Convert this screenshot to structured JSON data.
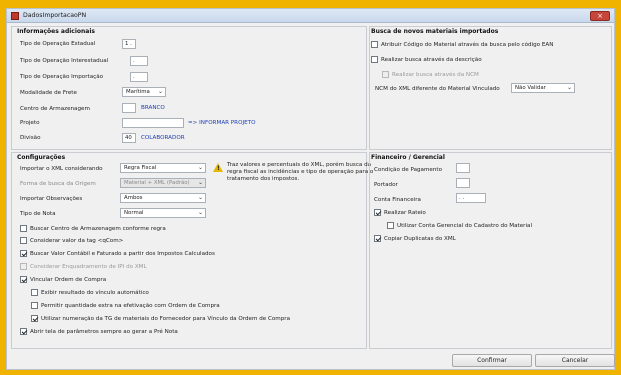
{
  "window": {
    "title": "DadosImportacaoPN",
    "close_glyph": "×",
    "app_icon": "app-icon"
  },
  "info": {
    "title": "Informações adicionais",
    "tipo_estadual": {
      "label": "Tipo de Operação Estadual",
      "value": "1  ."
    },
    "tipo_interestadual": {
      "label": "Tipo de Operação Interestadual",
      "value": "."
    },
    "tipo_importacao": {
      "label": "Tipo de Operação Importação",
      "value": "."
    },
    "modalidade": {
      "label": "Modalidade de Frete",
      "value": "Marítima"
    },
    "centro": {
      "label": "Centro de Armazenagem",
      "value": "",
      "link": "BRANCO"
    },
    "projeto": {
      "label": "Projeto",
      "value": "",
      "link": "=> INFORMAR PROJETO"
    },
    "divisao": {
      "label": "Divisão",
      "value": "40",
      "link": "COLABORADOR"
    }
  },
  "busca": {
    "title": "Busca de novos materiais importados",
    "opt1": "Atribuir Código do Material através da busca pelo código EAN",
    "opt2": "Realizar busca através da descrição",
    "opt3": "Realizar busca através da NCM",
    "ncm_label": "NCM do XML diferente do Material Vinculado",
    "ncm_value": "Não Validar"
  },
  "config": {
    "title": "Configurações",
    "importar": {
      "label": "Importar o XML considerando",
      "value": "Regra Fiscal"
    },
    "forma": {
      "label": "Forma de busca da Origem",
      "value": "Material + XML (Padrão)"
    },
    "observacoes": {
      "label": "Importar Observações",
      "value": "Ambos"
    },
    "tipo_nota": {
      "label": "Tipo de Nota",
      "value": "Normal"
    },
    "warning": "Traz valores e percentuais do XML, porém busca da regra fiscal as incidências e tipo de operação para o tratamento dos impostos.",
    "checks": [
      "Buscar Centro de Armazenagem conforme regra",
      "Considerar valor da tag <qCom>",
      "Buscar Valor Contábil e Faturado a partir dos Impostos Calculados",
      "Considerar Enquadramento de IPI do XML",
      "Vincular Ordem de Compra",
      "Exibir resultado do vínculo automático",
      "Permitir quantidade extra na efetivação com Ordem de Compra",
      "Utilizar numeração da TG de materiais do Fornecedor para Vínculo da Ordem de Compra",
      "Abrir tela de parâmetros sempre ao gerar a Pré Nota"
    ]
  },
  "fin": {
    "title": "Financeiro / Gerencial",
    "condicao": "Condição de Pagamento",
    "portador": "Portador",
    "conta": "Conta Financeira",
    "conta_value": ".  .",
    "rateio": "Realizar Rateio",
    "utilizar_conta": "Utilizar Conta Gerencial do Cadastro do Material",
    "copiar": "Copiar Duplicatas do XML"
  },
  "buttons": {
    "confirmar": "Confirmar",
    "cancelar": "Cancelar"
  }
}
